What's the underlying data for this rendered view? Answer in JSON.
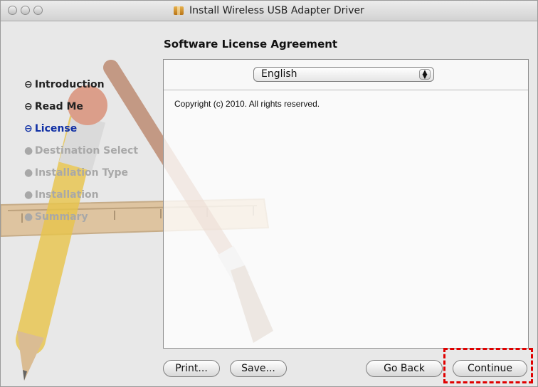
{
  "window": {
    "title": "Install Wireless USB Adapter Driver",
    "controls": [
      "close-button",
      "minimize-button",
      "zoom-button"
    ]
  },
  "header": {
    "title": "Software License Agreement"
  },
  "steps": [
    {
      "label": "Introduction",
      "state": "done"
    },
    {
      "label": "Read Me",
      "state": "done"
    },
    {
      "label": "License",
      "state": "current"
    },
    {
      "label": "Destination Select",
      "state": "todo"
    },
    {
      "label": "Installation Type",
      "state": "todo"
    },
    {
      "label": "Installation",
      "state": "todo"
    },
    {
      "label": "Summary",
      "state": "todo"
    }
  ],
  "language_select": {
    "value": "English"
  },
  "license": {
    "text": "Copyright (c) 2010.  All rights reserved."
  },
  "buttons": {
    "print": "Print...",
    "save": "Save...",
    "go_back": "Go Back",
    "continue": "Continue"
  },
  "colors": {
    "accent": "#0f2fa5",
    "highlight": "#e00000"
  },
  "icons": {
    "package": "package-icon",
    "select": "select-arrows-icon"
  }
}
